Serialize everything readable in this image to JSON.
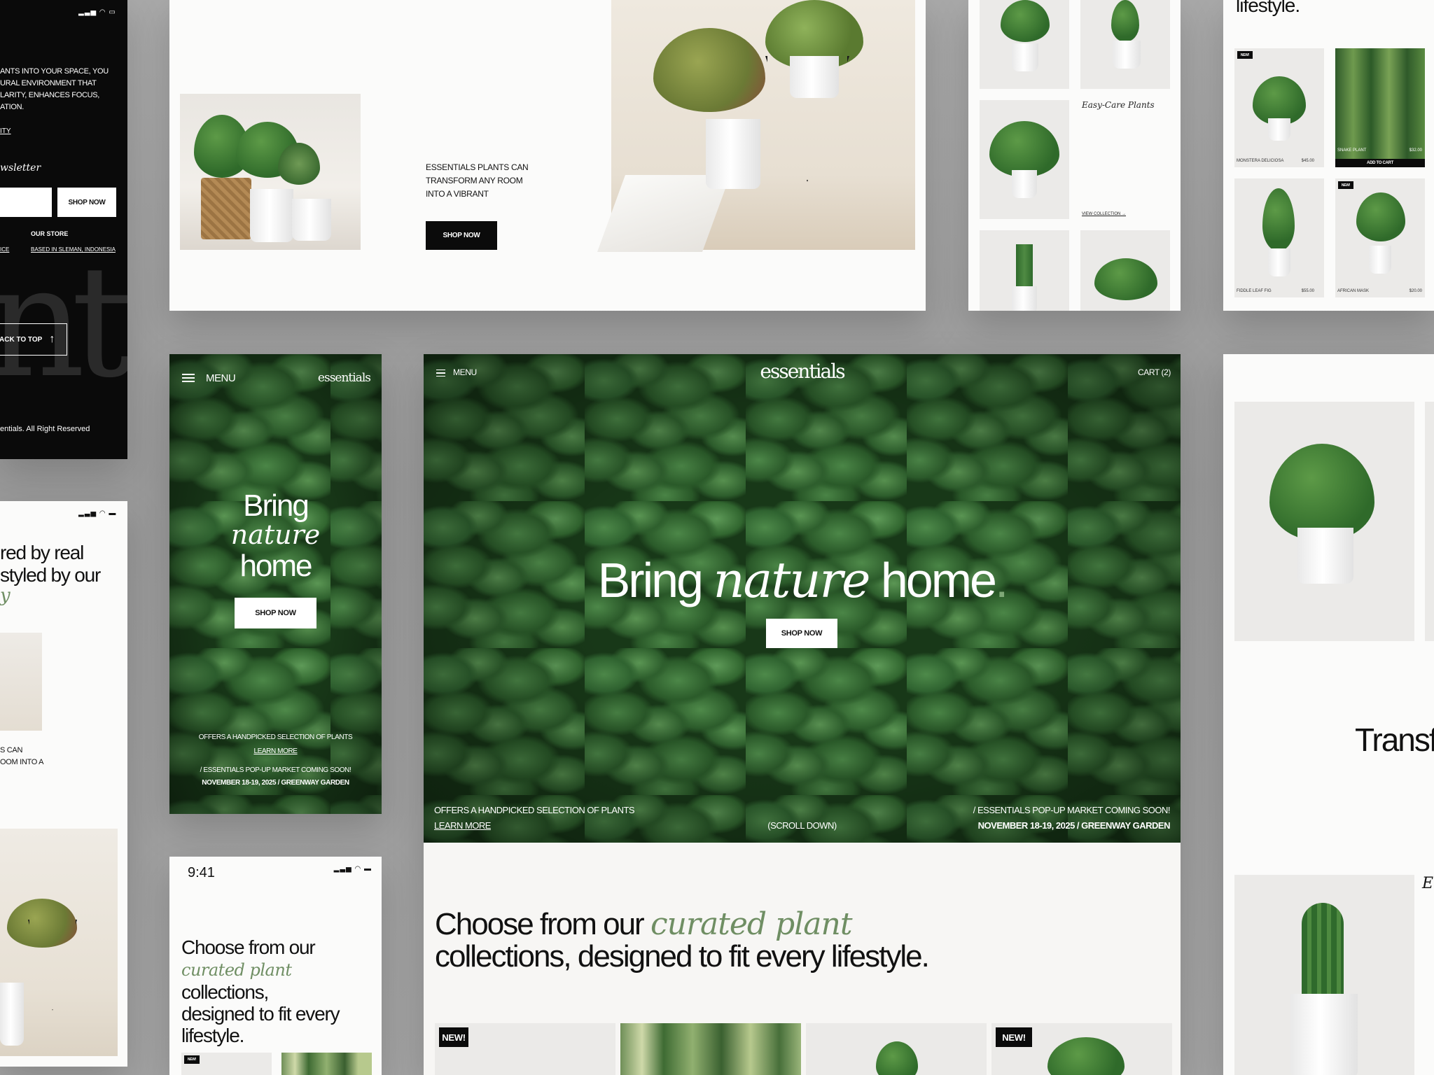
{
  "brand": "essentials",
  "mobile_footer": {
    "about_text": "ANTS INTO YOUR SPACE, YOU\nURAL ENVIRONMENT THAT\nLARITY, ENHANCES FOCUS,\nATION.",
    "link_fragment": "ITY",
    "newsletter_label": "wsletter",
    "shop_now": "SHOP NOW",
    "our_store_label": "OUR STORE",
    "ice_fragment": "ICE",
    "store_location": "BASED IN SLEMAN, INDONESIA",
    "back_to_top": "ACK TO TOP",
    "copyright": "entials. All Right Reserved"
  },
  "top_card": {
    "description": "ESSENTIALS PLANTS CAN\nTRANSFORM ANY ROOM\nINTO A VIBRANT",
    "button": "SHOP NOW"
  },
  "collection_card": {
    "heading": "Easy-Care Plants",
    "link": "VIEW COLLECTION →"
  },
  "product_grid": {
    "heading_fragment": "lifestyle.",
    "badge": "NEW!",
    "products": [
      {
        "name": "MONSTERA DELICIOSA",
        "price": "$45.00"
      },
      {
        "name": "SNAKE PLANT",
        "price": "$32.00",
        "cta": "ADD TO CART"
      },
      {
        "name": "FIDDLE LEAF FIG",
        "price": "$55.00"
      },
      {
        "name": "AFRICAN MASK",
        "price": "$20.00"
      }
    ]
  },
  "mobile_hero": {
    "menu": "MENU",
    "logo": "essentials",
    "line1": "Bring",
    "line2": "nature",
    "line3": "home",
    "button": "SHOP NOW",
    "offer": "OFFERS A HANDPICKED SELECTION OF PLANTS",
    "learn_more": "LEARN MORE",
    "popup": "/ ESSENTIALS POP-UP MARKET COMING SOON!",
    "date": "NOVEMBER 18-19, 2025 / GREENWAY GARDEN"
  },
  "desktop_hero": {
    "menu": "MENU",
    "logo": "essentials",
    "cart": "CART (2)",
    "title_a": "Bring ",
    "title_b": "nature",
    "title_c": " home",
    "button": "SHOP NOW",
    "offer": "OFFERS A HANDPICKED SELECTION OF PLANTS",
    "learn_more": "LEARN MORE",
    "scroll": "(SCROLL DOWN)",
    "popup": "/ ESSENTIALS POP-UP MARKET COMING SOON!",
    "date": "NOVEMBER 18-19, 2025 / GREENWAY GARDEN",
    "section_a": "Choose from our ",
    "section_b": "curated plant",
    "section_c": "collections, designed to fit every lifestyle.",
    "badge": "NEW!"
  },
  "mobile_testimonial": {
    "line1": "red by real",
    "line2": "styled by our",
    "line3": "y",
    "text": "S CAN\nOOM INTO A"
  },
  "mobile_collections": {
    "time": "9:41",
    "line1": "Choose from our",
    "line2_it": "curated plant",
    "line2_rest": " collections,",
    "line3": "designed to fit every",
    "line4": "lifestyle.",
    "badge": "NEW!"
  },
  "right_card": {
    "heading_fragment": "Transf",
    "italic_fragment": "E"
  }
}
